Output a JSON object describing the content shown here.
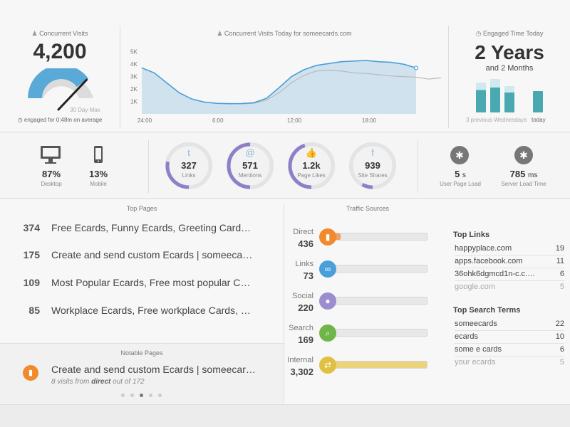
{
  "concurrent": {
    "title": "Concurrent Visits",
    "value": "4,200",
    "gauge_fraction": 0.8,
    "max_label": "30 Day Max",
    "engaged_label": "engaged for 0:48m on average"
  },
  "chart_panel": {
    "title": "Concurrent Visits Today for someecards.com"
  },
  "chart_data": {
    "type": "area",
    "title": "Concurrent Visits Today for someecards.com",
    "x_ticks": [
      "24:00",
      "6:00",
      "12:00",
      "18:00"
    ],
    "y_ticks": [
      "1K",
      "2K",
      "3K",
      "4K",
      "5K"
    ],
    "ylim": [
      0,
      5500
    ],
    "xlim": [
      0,
      24
    ],
    "series": [
      {
        "values": [
          [
            0,
            3700
          ],
          [
            1,
            3300
          ],
          [
            2,
            2500
          ],
          [
            3,
            1700
          ],
          [
            4,
            1200
          ],
          [
            5,
            950
          ],
          [
            6,
            850
          ],
          [
            7,
            820
          ],
          [
            8,
            830
          ],
          [
            9,
            900
          ],
          [
            10,
            1250
          ],
          [
            11,
            2100
          ],
          [
            12,
            3000
          ],
          [
            13,
            3550
          ],
          [
            14,
            3900
          ],
          [
            15,
            4050
          ],
          [
            16,
            4200
          ],
          [
            17,
            4250
          ],
          [
            18,
            4300
          ],
          [
            19,
            4200
          ],
          [
            20,
            4150
          ],
          [
            21,
            4000
          ],
          [
            22,
            3700
          ]
        ]
      },
      {
        "values": [
          [
            0,
            3700
          ],
          [
            1,
            3300
          ],
          [
            2,
            2500
          ],
          [
            3,
            1700
          ],
          [
            4,
            1200
          ],
          [
            5,
            950
          ],
          [
            6,
            850
          ],
          [
            7,
            820
          ],
          [
            8,
            800
          ],
          [
            9,
            850
          ],
          [
            10,
            1100
          ],
          [
            11,
            1700
          ],
          [
            12,
            2500
          ],
          [
            13,
            3100
          ],
          [
            14,
            3450
          ],
          [
            15,
            3500
          ],
          [
            16,
            3450
          ],
          [
            17,
            3300
          ],
          [
            18,
            3250
          ],
          [
            19,
            3150
          ],
          [
            20,
            3050
          ],
          [
            21,
            3000
          ],
          [
            22,
            2950
          ],
          [
            23,
            2800
          ],
          [
            24,
            2900
          ]
        ]
      }
    ]
  },
  "engaged": {
    "title": "Engaged Time Today",
    "value": "2 Years",
    "sub": "and 2 Months",
    "prev_label": "3 previous Wednesdays",
    "today_label": "today",
    "bars": [
      0.85,
      0.95,
      0.75,
      0.6
    ]
  },
  "devices": [
    {
      "icon": "desktop-icon",
      "value": "87%",
      "label": "Desktop"
    },
    {
      "icon": "mobile-icon",
      "value": "13%",
      "label": "Mobile"
    }
  ],
  "social": [
    {
      "icon": "twitter-icon",
      "glyph": "t",
      "value": "327",
      "label": "Links",
      "fraction": 0.28
    },
    {
      "icon": "mention-icon",
      "glyph": "@",
      "value": "571",
      "label": "Mentions",
      "fraction": 0.5
    },
    {
      "icon": "thumb-icon",
      "glyph": "👍",
      "value": "1.2k",
      "label": "Page Likes",
      "fraction": 0.45
    },
    {
      "icon": "facebook-icon",
      "glyph": "f",
      "value": "939",
      "label": "Site Shares",
      "fraction": 0.08
    }
  ],
  "load": [
    {
      "icon": "walker-icon",
      "value": "5",
      "unit": "s",
      "label": "User Page Load"
    },
    {
      "icon": "walker-icon",
      "value": "785",
      "unit": "ms",
      "label": "Server Load Time"
    }
  ],
  "top_pages": {
    "title": "Top Pages",
    "rows": [
      {
        "count": "374",
        "title": "Free Ecards, Funny Ecards, Greeting Card…"
      },
      {
        "count": "175",
        "title": "Create and send custom Ecards | someeca…"
      },
      {
        "count": "109",
        "title": "Most Popular Ecards, Free most popular C…"
      },
      {
        "count": "85",
        "title": "Workplace Ecards, Free workplace Cards, …"
      }
    ]
  },
  "notable": {
    "title": "Notable Pages",
    "page_title": "Create and send custom Ecards | someecar…",
    "visits_prefix": "8 visits from",
    "visits_source": "direct",
    "visits_suffix": "out of 172",
    "pager_active": 2
  },
  "traffic": {
    "title": "Traffic Sources",
    "sources": [
      {
        "name": "Direct",
        "value": "436",
        "icon": "bookmark-icon",
        "glyph": "▮",
        "color": "#f08a2c",
        "fill": "#f0a060",
        "fraction": 0.12
      },
      {
        "name": "Links",
        "value": "73",
        "icon": "link-icon",
        "glyph": "∞",
        "color": "#4a9fd8",
        "fill": "#8cc4ea",
        "fraction": 0.02
      },
      {
        "name": "Social",
        "value": "220",
        "icon": "chat-icon",
        "glyph": "●",
        "color": "#9b8dd0",
        "fill": "#b8addf",
        "fraction": 0.06
      },
      {
        "name": "Search",
        "value": "169",
        "icon": "search-icon",
        "glyph": "⌕",
        "color": "#6fb548",
        "fill": "#a6d58a",
        "fraction": 0.05
      },
      {
        "name": "Internal",
        "value": "3,302",
        "icon": "swap-icon",
        "glyph": "⇄",
        "color": "#e0c040",
        "fill": "#ead37a",
        "fraction": 1.0
      }
    ]
  },
  "top_links": {
    "title": "Top Links",
    "rows": [
      {
        "name": "happyplace.com",
        "value": "19"
      },
      {
        "name": "apps.facebook.com",
        "value": "11"
      },
      {
        "name": "36ohk6dgmcd1n-c.c.…",
        "value": "6"
      },
      {
        "name": "google.com",
        "value": "5"
      }
    ]
  },
  "top_search": {
    "title": "Top Search Terms",
    "rows": [
      {
        "name": "someecards",
        "value": "22"
      },
      {
        "name": "ecards",
        "value": "10"
      },
      {
        "name": "some e cards",
        "value": "6"
      },
      {
        "name": "your ecards",
        "value": "5"
      }
    ]
  },
  "colors": {
    "accent_blue": "#4a9fd8",
    "area_fill": "#cfe2ee",
    "teal": "#4aa8b0",
    "purple": "#8e7fc8"
  }
}
